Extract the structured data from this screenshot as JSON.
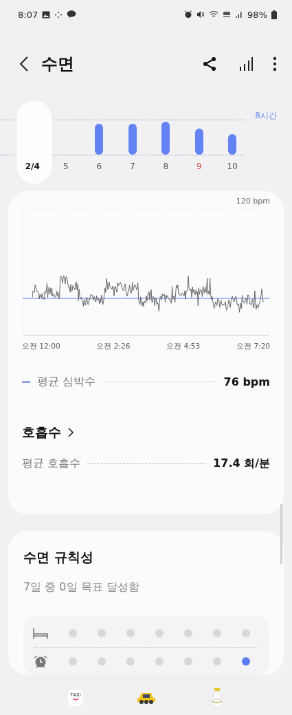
{
  "status_bar": {
    "time": "8:07",
    "battery": "98%"
  },
  "header": {
    "title": "수면"
  },
  "days": {
    "goal_label": "8시간",
    "items": [
      {
        "label": "2/4",
        "selected": true,
        "holiday": false
      },
      {
        "label": "5",
        "selected": false,
        "holiday": false
      },
      {
        "label": "6",
        "selected": false,
        "holiday": false
      },
      {
        "label": "7",
        "selected": false,
        "holiday": false
      },
      {
        "label": "8",
        "selected": false,
        "holiday": false
      },
      {
        "label": "9",
        "selected": false,
        "holiday": true
      },
      {
        "label": "10",
        "selected": false,
        "holiday": false
      }
    ]
  },
  "heart_card": {
    "y_top_label": "120 bpm",
    "x_labels": [
      "오전 12:00",
      "오전 2:26",
      "오전 4:53",
      "오전 7:20"
    ],
    "average": {
      "label": "평균 심박수",
      "value": "76 bpm"
    },
    "respiration": {
      "title": "호흡수",
      "label": "평균 호흡수",
      "value": "17.4 회/분"
    }
  },
  "regularity": {
    "title": "수면 규칙성",
    "summary": "7일 중 0일 목표 달성함",
    "rows": [
      {
        "kind": "bedtime",
        "days": [
          false,
          false,
          false,
          false,
          false,
          false,
          false
        ]
      },
      {
        "kind": "wake",
        "days": [
          false,
          false,
          false,
          false,
          false,
          false,
          true
        ]
      }
    ]
  },
  "bottom_bar": [
    {
      "kind": "taxi-sign",
      "label": "TAXI"
    },
    {
      "kind": "car"
    },
    {
      "kind": "figure"
    }
  ]
}
